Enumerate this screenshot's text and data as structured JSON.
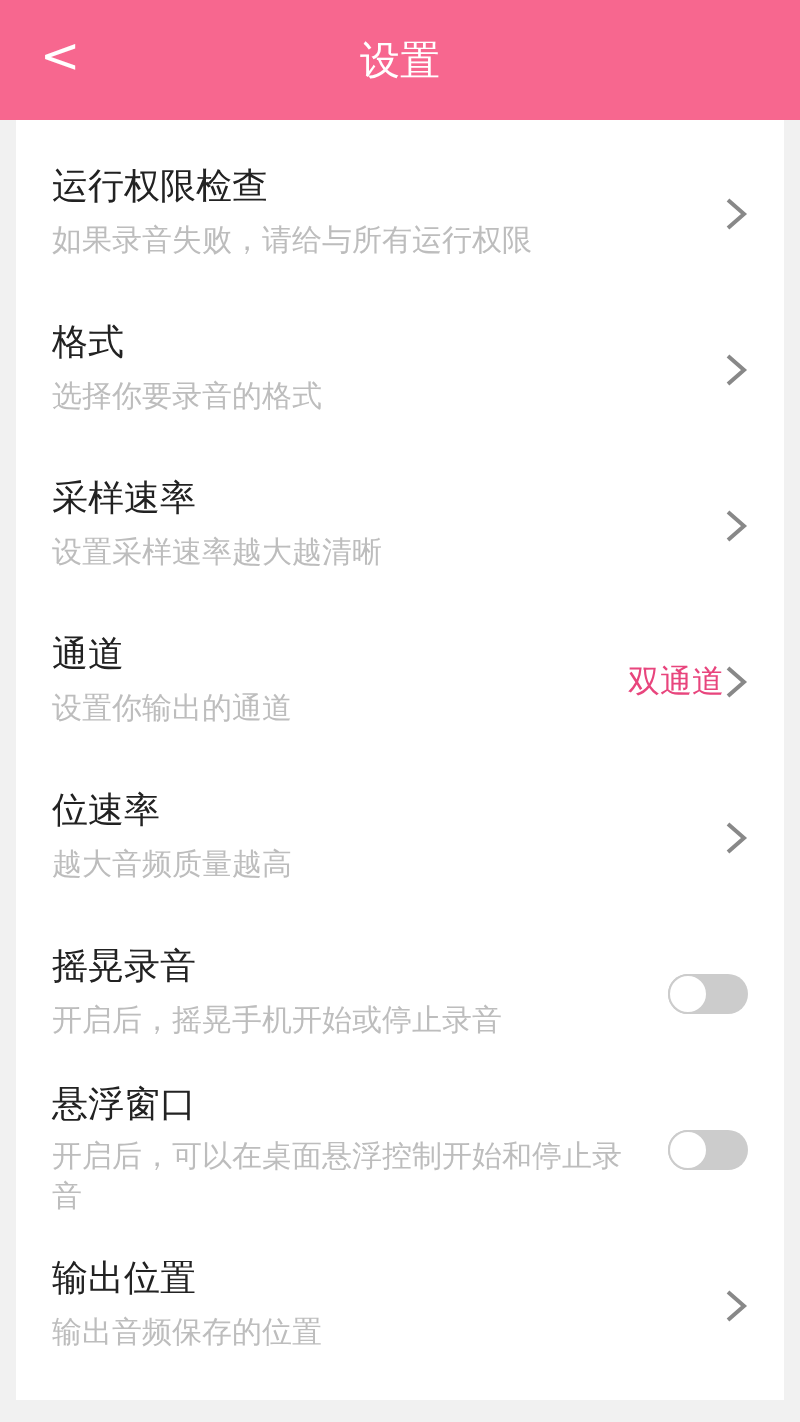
{
  "header": {
    "back": "<",
    "title": "设置"
  },
  "settings": [
    {
      "kind": "link",
      "title": "运行权限检查",
      "subtitle": "如果录音失败，请给与所有运行权限"
    },
    {
      "kind": "link",
      "title": "格式",
      "subtitle": "选择你要录音的格式"
    },
    {
      "kind": "link",
      "title": "采样速率",
      "subtitle": "设置采样速率越大越清晰"
    },
    {
      "kind": "link",
      "title": "通道",
      "subtitle": "设置你输出的通道",
      "value": "双通道"
    },
    {
      "kind": "link",
      "title": "位速率",
      "subtitle": "越大音频质量越高"
    },
    {
      "kind": "toggle",
      "title": "摇晃录音",
      "subtitle": "开启后，摇晃手机开始或停止录音",
      "on": false
    },
    {
      "kind": "toggle",
      "title": "悬浮窗口",
      "subtitle": "开启后，可以在桌面悬浮控制开始和停止录音",
      "on": false
    },
    {
      "kind": "link",
      "title": "输出位置",
      "subtitle": "输出音频保存的位置"
    }
  ]
}
